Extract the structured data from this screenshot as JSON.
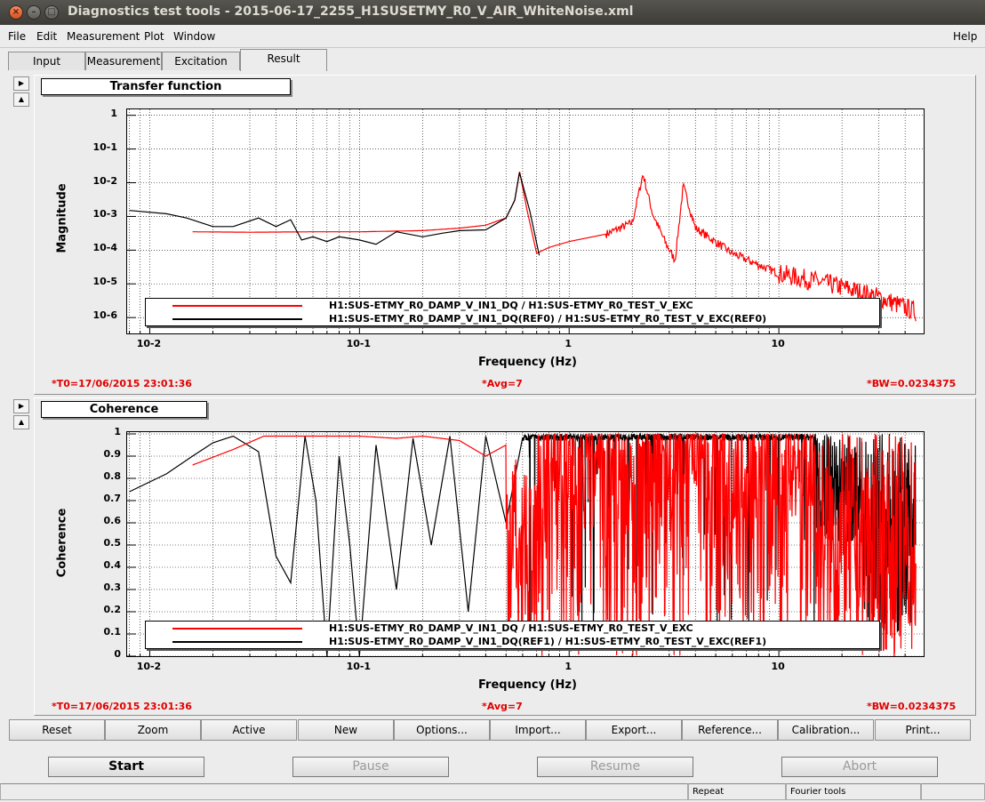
{
  "window": {
    "title": "Diagnostics test tools - 2015-06-17_2255_H1SUSETMY_R0_V_AIR_WhiteNoise.xml"
  },
  "menu": {
    "file": "File",
    "edit": "Edit",
    "measurement": "Measurement",
    "plot": "Plot",
    "window": "Window",
    "help": "Help"
  },
  "tabs": [
    "Input",
    "Measurement",
    "Excitation",
    "Result"
  ],
  "plot1": {
    "title": "Transfer function",
    "ylabel": "Magnitude",
    "xlabel": "Frequency (Hz)",
    "yticks": [
      "1",
      "10-1",
      "10-2",
      "10-3",
      "10-4",
      "10-5",
      "10-6"
    ],
    "xticks": [
      "10-2",
      "10-1",
      "1",
      "10"
    ],
    "legend": [
      "H1:SUS-ETMY_R0_DAMP_V_IN1_DQ / H1:SUS-ETMY_R0_TEST_V_EXC",
      "H1:SUS-ETMY_R0_DAMP_V_IN1_DQ(REF0) / H1:SUS-ETMY_R0_TEST_V_EXC(REF0)"
    ],
    "t0": "*T0=17/06/2015 23:01:36",
    "avg": "*Avg=7",
    "bw": "*BW=0.0234375"
  },
  "plot2": {
    "title": "Coherence",
    "ylabel": "Coherence",
    "xlabel": "Frequency (Hz)",
    "yticks": [
      "1",
      "0.9",
      "0.8",
      "0.7",
      "0.6",
      "0.5",
      "0.4",
      "0.3",
      "0.2",
      "0.1",
      "0"
    ],
    "xticks": [
      "10-2",
      "10-1",
      "1",
      "10"
    ],
    "legend": [
      "H1:SUS-ETMY_R0_DAMP_V_IN1_DQ / H1:SUS-ETMY_R0_TEST_V_EXC",
      "H1:SUS-ETMY_R0_DAMP_V_IN1_DQ(REF1) / H1:SUS-ETMY_R0_TEST_V_EXC(REF1)"
    ],
    "t0": "*T0=17/06/2015 23:01:36",
    "avg": "*Avg=7",
    "bw": "*BW=0.0234375"
  },
  "plot_buttons": [
    "Reset",
    "Zoom",
    "Active",
    "New",
    "Options...",
    "Import...",
    "Export...",
    "Reference...",
    "Calibration...",
    "Print..."
  ],
  "control_buttons": {
    "start": "Start",
    "pause": "Pause",
    "resume": "Resume",
    "abort": "Abort"
  },
  "status": {
    "mode": "Repeat",
    "tool": "Fourier tools"
  },
  "colors": {
    "current": "#ff0000",
    "reference": "#000000",
    "stats": "#e00000"
  },
  "chart_data": [
    {
      "type": "line",
      "title": "Transfer function",
      "xlabel": "Frequency (Hz)",
      "ylabel": "Magnitude",
      "xscale": "log",
      "yscale": "log",
      "xlim": [
        0.0078,
        50
      ],
      "ylim": [
        3e-07,
        1.5
      ],
      "grid": true,
      "legend_position": "bottom",
      "series": [
        {
          "name": "H1:SUS-ETMY_R0_DAMP_V_IN1_DQ / H1:SUS-ETMY_R0_TEST_V_EXC",
          "x": [
            0.016,
            0.03,
            0.06,
            0.1,
            0.2,
            0.3,
            0.4,
            0.5,
            0.55,
            0.58,
            0.63,
            0.7,
            0.8,
            1.0,
            1.5,
            2.0,
            2.25,
            2.5,
            2.9,
            3.2,
            3.5,
            4,
            6,
            10,
            15,
            20,
            30,
            45
          ],
          "y": [
            0.00035,
            0.00034,
            0.00035,
            0.00035,
            0.00038,
            0.00045,
            0.00055,
            0.0009,
            0.003,
            0.022,
            0.0015,
            8e-05,
            0.00012,
            0.00018,
            0.0003,
            0.00065,
            0.018,
            0.0012,
            0.00015,
            5e-05,
            0.008,
            0.00045,
            8e-05,
            2e-05,
            1.2e-05,
            8e-06,
            4e-06,
            1.5e-06
          ]
        },
        {
          "name": "H1:SUS-ETMY_R0_DAMP_V_IN1_DQ(REF0) / H1:SUS-ETMY_R0_TEST_V_EXC(REF0)",
          "x": [
            0.008,
            0.012,
            0.015,
            0.02,
            0.025,
            0.033,
            0.04,
            0.047,
            0.053,
            0.06,
            0.07,
            0.08,
            0.1,
            0.12,
            0.15,
            0.2,
            0.25,
            0.3,
            0.4,
            0.5,
            0.55,
            0.58,
            0.65,
            0.72
          ],
          "y": [
            0.0015,
            0.0012,
            0.0009,
            0.0005,
            0.0005,
            0.0009,
            0.0005,
            0.0008,
            0.0002,
            0.00025,
            0.00018,
            0.00025,
            0.0002,
            0.00015,
            0.00035,
            0.00025,
            0.00032,
            0.00038,
            0.0004,
            0.0009,
            0.003,
            0.02,
            0.0014,
            7e-05
          ]
        }
      ]
    },
    {
      "type": "line",
      "title": "Coherence",
      "xlabel": "Frequency (Hz)",
      "ylabel": "Coherence",
      "xscale": "log",
      "xlim": [
        0.0078,
        50
      ],
      "ylim": [
        0,
        1
      ],
      "grid": true,
      "legend_position": "bottom",
      "series": [
        {
          "name": "H1:SUS-ETMY_R0_DAMP_V_IN1_DQ / H1:SUS-ETMY_R0_TEST_V_EXC",
          "x": [
            0.016,
            0.025,
            0.035,
            0.05,
            0.1,
            0.15,
            0.2,
            0.3,
            0.4,
            0.5,
            0.55,
            0.6,
            0.7,
            1.0,
            1.5,
            2,
            3,
            4,
            6,
            10,
            15,
            20,
            30,
            45
          ],
          "y": [
            0.86,
            0.93,
            0.99,
            0.99,
            0.99,
            0.98,
            0.99,
            0.97,
            0.9,
            0.95,
            0.6,
            0.1,
            0.95,
            0.95,
            0.7,
            0.9,
            0.3,
            0.8,
            0.5,
            0.6,
            0.2,
            0.4,
            0.1,
            0.1
          ]
        },
        {
          "name": "H1:SUS-ETMY_R0_DAMP_V_IN1_DQ(REF1) / H1:SUS-ETMY_R0_TEST_V_EXC(REF1)",
          "x": [
            0.008,
            0.012,
            0.016,
            0.02,
            0.025,
            0.033,
            0.04,
            0.047,
            0.055,
            0.062,
            0.07,
            0.08,
            0.09,
            0.1,
            0.12,
            0.15,
            0.18,
            0.22,
            0.27,
            0.33,
            0.4,
            0.5,
            0.6,
            1,
            2,
            5,
            10,
            20,
            45
          ],
          "y": [
            0.74,
            0.82,
            0.9,
            0.96,
            0.99,
            0.92,
            0.45,
            0.33,
            0.99,
            0.7,
            0.0,
            0.9,
            0.5,
            0.0,
            0.95,
            0.3,
            0.98,
            0.5,
            0.99,
            0.2,
            0.99,
            0.6,
            0.0,
            0.99,
            0.99,
            0.99,
            0.99,
            0.95,
            0.9
          ]
        }
      ]
    }
  ]
}
